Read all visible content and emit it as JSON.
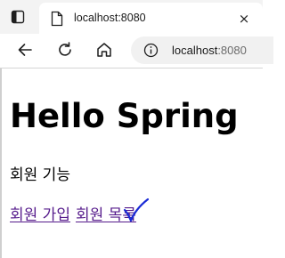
{
  "browser": {
    "tab_title": "localhost:8080",
    "tab_close": "×",
    "url_host": "localhost",
    "url_port": ":8080"
  },
  "page": {
    "heading": "Hello Spring",
    "section_label": "회원 기능",
    "links": [
      {
        "label": "회원 가입"
      },
      {
        "label": "회원 목록"
      }
    ]
  },
  "colors": {
    "visited_link": "#551a8b",
    "cursor_mark": "#1a2bd6"
  },
  "icons": {
    "tab_actions": "tab-actions-icon",
    "favicon": "page-icon",
    "back": "back-arrow-icon",
    "refresh": "refresh-icon",
    "home": "home-icon",
    "info": "info-icon",
    "cursor": "check-mark-icon"
  }
}
